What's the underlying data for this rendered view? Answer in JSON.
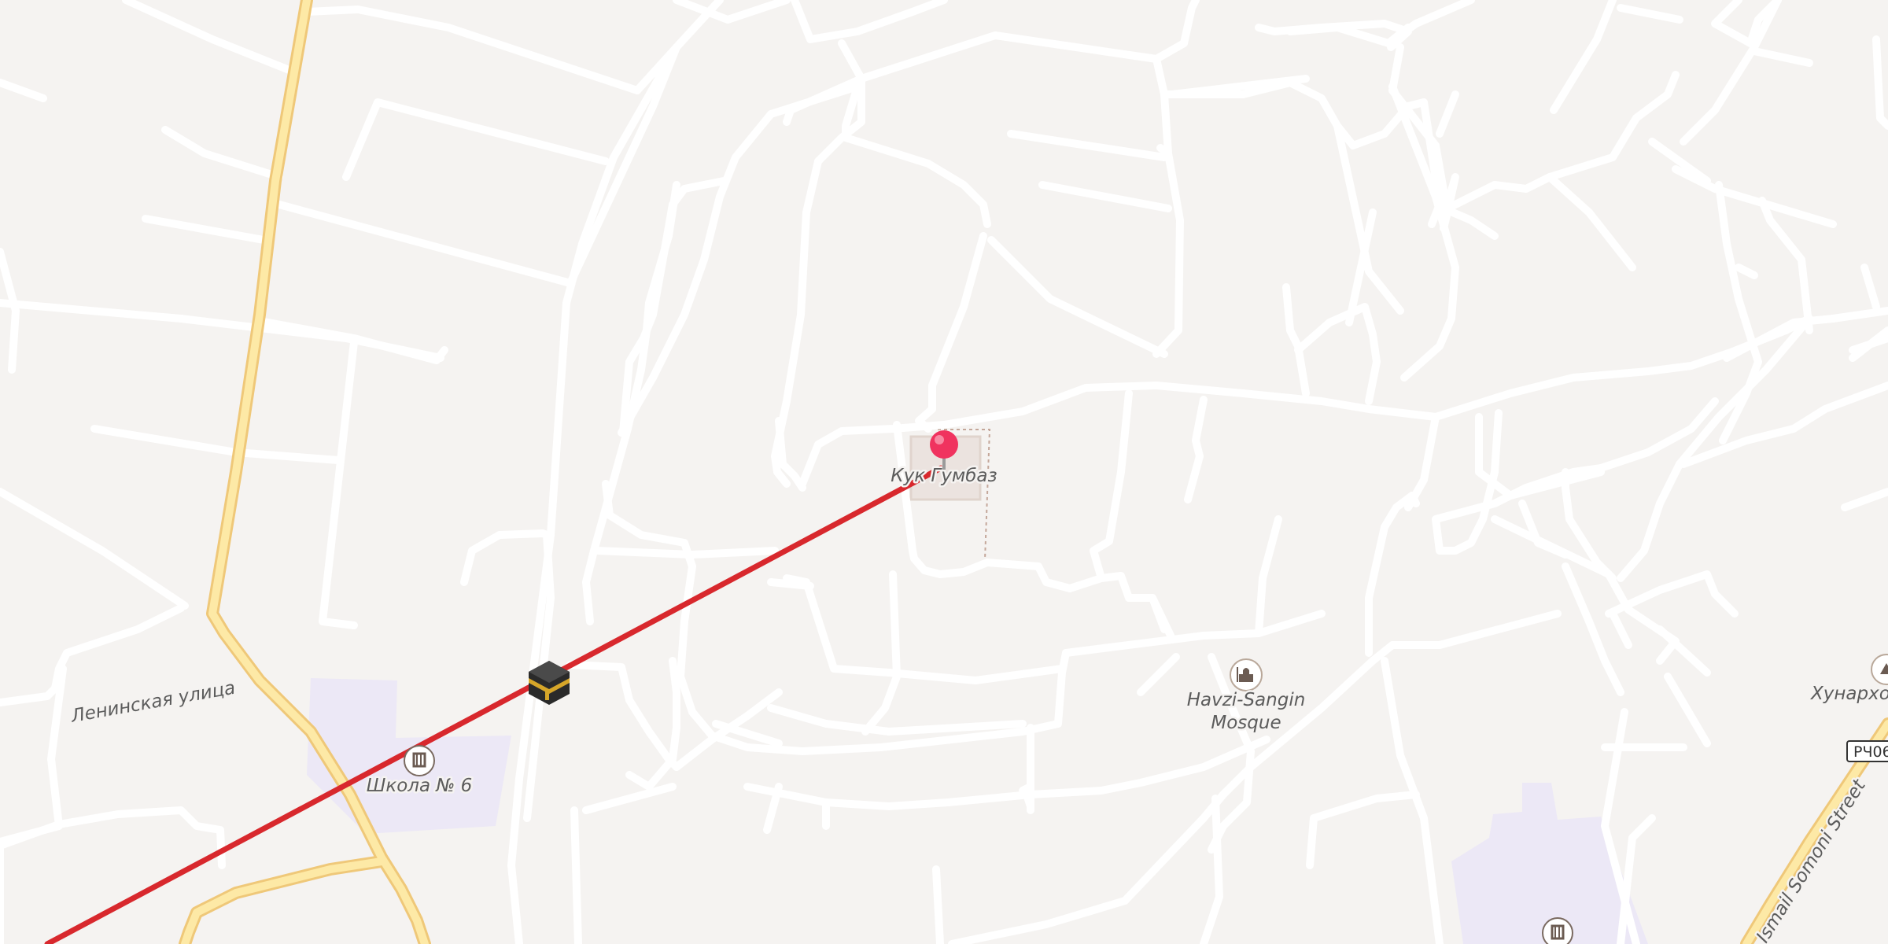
{
  "map": {
    "labels": {
      "kuk_gumbaz": "Кук Гумбаз",
      "lenin_street": "Ленинская улица",
      "school_6": "Школа № 6",
      "havzi_sangin_line1": "Havzi-Sangin",
      "havzi_sangin_line2": "Mosque",
      "hunarkhoi": "Хунархои",
      "ismail_somoni": "Ismail Somoni Street",
      "road_shield": "РЧ06"
    },
    "markers": {
      "destination_pin": "red-map-pin",
      "origin": "kaaba-icon"
    },
    "icons": {
      "school": "school-icon",
      "mosque": "mosque-icon",
      "arts": "arts-icon"
    },
    "colors": {
      "background": "#f5f3f1",
      "road": "#ffffff",
      "major_road": "#fde9a6",
      "major_road_casing": "#efc879",
      "qibla_line": "#d8282d",
      "school_area": "#ece8f6",
      "pin": "#f0335f"
    }
  }
}
